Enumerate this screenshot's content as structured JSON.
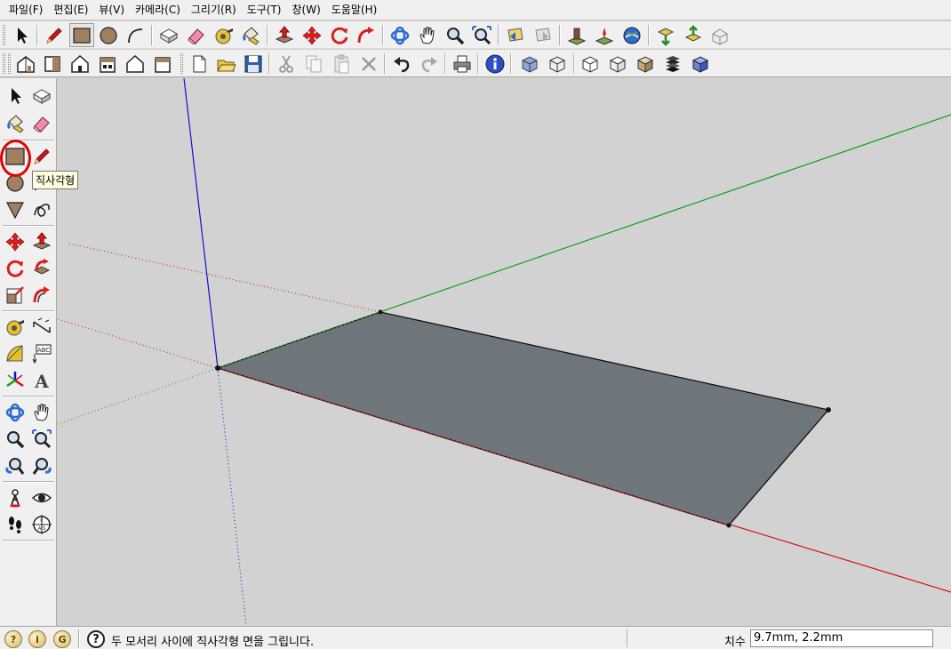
{
  "menu": [
    "파일(F)",
    "편집(E)",
    "뷰(V)",
    "카메라(C)",
    "그리기(R)",
    "도구(T)",
    "창(W)",
    "도움말(H)"
  ],
  "toolbar1": {
    "icons": [
      "select-arrow",
      "pencil-line",
      "rectangle",
      "circle",
      "arc",
      "make-component",
      "eraser",
      "tape-measure",
      "paint-bucket",
      "push-pull",
      "move",
      "rotate",
      "follow-me",
      "orbit",
      "pan",
      "zoom",
      "zoom-extents",
      "previous-view",
      "next-view",
      "add-location",
      "toggle-terrain",
      "google-earth",
      "get-models",
      "share-model",
      "photo-textures"
    ]
  },
  "toolbar2": {
    "icons": [
      "iso-view",
      "top-view",
      "front-view",
      "right-view",
      "back-view",
      "left-view",
      "new",
      "open",
      "save",
      "cut",
      "copy",
      "paste",
      "delete",
      "undo",
      "redo",
      "print",
      "model-info",
      "xray",
      "wireframe",
      "hidden-line",
      "shaded",
      "shaded-textures",
      "monochrome"
    ]
  },
  "lefttoolbar": {
    "selected": "rectangle-tool"
  },
  "tooltip": "직사각형",
  "status": {
    "message": "두 모서리 사이에 직사각형 면을 그립니다.",
    "measure_label": "치수",
    "measure_value": "9.7mm, 2.2mm"
  },
  "colors": {
    "face_fill": "#6e767c",
    "axis_red": "#d21414",
    "axis_green": "#14a014",
    "axis_blue": "#1010cc",
    "highlight": "#e20000",
    "background": "#d2d2d2"
  }
}
